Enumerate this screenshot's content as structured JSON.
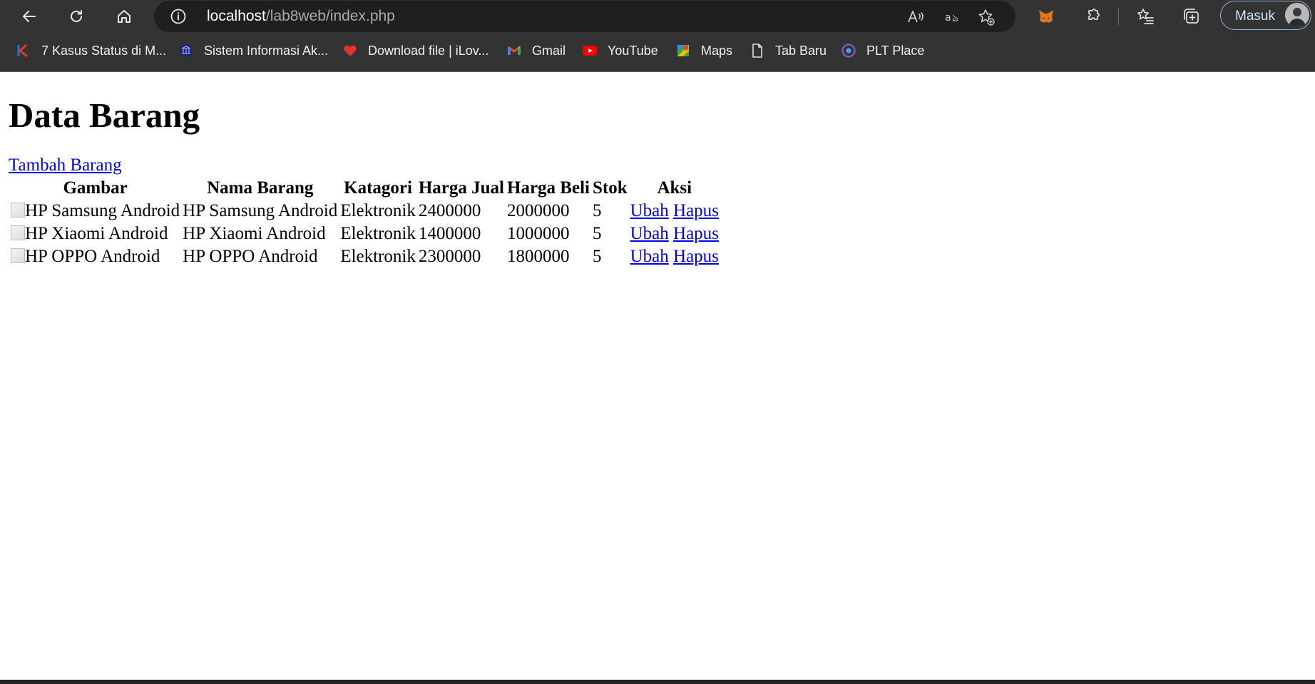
{
  "browser": {
    "url_host": "localhost",
    "url_path": "/lab8web/index.php",
    "signin_label": "Masuk",
    "bookmarks": [
      {
        "label": "7 Kasus Status di M...",
        "icon": "kasus-icon"
      },
      {
        "label": "Sistem Informasi Ak...",
        "icon": "university-icon"
      },
      {
        "label": "Download file | iLov...",
        "icon": "ilovepdf-heart-icon"
      },
      {
        "label": "Gmail",
        "icon": "gmail-icon"
      },
      {
        "label": "YouTube",
        "icon": "youtube-icon"
      },
      {
        "label": "Maps",
        "icon": "maps-icon"
      },
      {
        "label": "Tab Baru",
        "icon": "page-icon"
      },
      {
        "label": "PLT Place",
        "icon": "plt-icon"
      }
    ]
  },
  "page": {
    "title": "Data Barang",
    "add_link": "Tambah Barang",
    "table": {
      "headers": [
        "Gambar",
        "Nama Barang",
        "Katagori",
        "Harga Jual",
        "Harga Beli",
        "Stok",
        "Aksi"
      ],
      "rows": [
        {
          "gambar_alt": "HP Samsung Android",
          "nama": "HP Samsung Android",
          "kategori": "Elektronik",
          "harga_jual": "2400000",
          "harga_beli": "2000000",
          "stok": "5",
          "ubah": "Ubah",
          "hapus": "Hapus"
        },
        {
          "gambar_alt": "HP Xiaomi Android",
          "nama": "HP Xiaomi Android",
          "kategori": "Elektronik",
          "harga_jual": "1400000",
          "harga_beli": "1000000",
          "stok": "5",
          "ubah": "Ubah",
          "hapus": "Hapus"
        },
        {
          "gambar_alt": "HP OPPO Android",
          "nama": "HP OPPO Android",
          "kategori": "Elektronik",
          "harga_jual": "2300000",
          "harga_beli": "1800000",
          "stok": "5",
          "ubah": "Ubah",
          "hapus": "Hapus"
        }
      ]
    }
  },
  "colors": {
    "chrome_bg": "#333333",
    "address_bg": "#1f1f1f",
    "link": "#0000ee",
    "signin_border": "#8fb4dd"
  }
}
